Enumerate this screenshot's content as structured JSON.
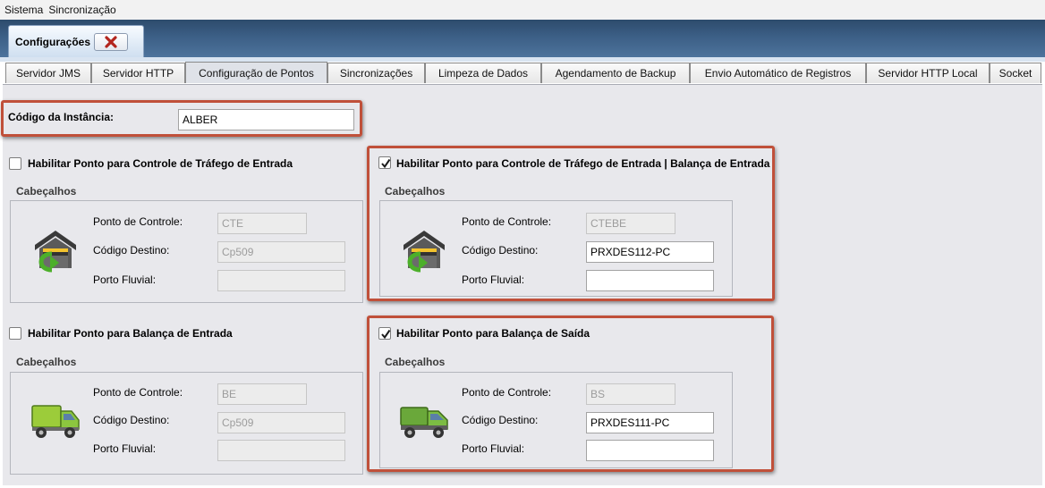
{
  "menu": {
    "items": [
      "Sistema",
      "Sincronização"
    ]
  },
  "app_tab": {
    "label": "Configurações"
  },
  "tabs": [
    "Servidor JMS",
    "Servidor HTTP",
    "Configuração de Pontos",
    "Sincronizações",
    "Limpeza de Dados",
    "Agendamento de Backup",
    "Envio Automático de Registros",
    "Servidor HTTP Local",
    "Socket"
  ],
  "active_tab": "Configuração de Pontos",
  "instance": {
    "label": "Código da Instância:",
    "value": "ALBER"
  },
  "field_labels": {
    "ponto": "Ponto de Controle:",
    "destino": "Código Destino:",
    "fluvial": "Porto Fluvial:"
  },
  "sections": {
    "trafego_entrada": {
      "checkbox_label": "Habilitar Ponto para Controle de Tráfego de Entrada",
      "checked": false,
      "header": "Cabeçalhos",
      "ponto": "CTE",
      "destino": "Cp509",
      "fluvial": "",
      "icon": "garage-arrow-icon"
    },
    "trafego_balanca_entrada": {
      "checkbox_label": "Habilitar Ponto para Controle de Tráfego de Entrada | Balança de Entrada",
      "checked": true,
      "header": "Cabeçalhos",
      "ponto": "CTEBE",
      "destino": "PRXDES112-PC",
      "fluvial": "",
      "icon": "garage-arrow-icon"
    },
    "balanca_entrada": {
      "checkbox_label": "Habilitar Ponto para Balança de Entrada",
      "checked": false,
      "header": "Cabeçalhos",
      "ponto": "BE",
      "destino": "Cp509",
      "fluvial": "",
      "icon": "truck-icon"
    },
    "balanca_saida": {
      "checkbox_label": "Habilitar Ponto para Balança de Saída",
      "checked": true,
      "header": "Cabeçalhos",
      "ponto": "BS",
      "destino": "PRXDES111-PC",
      "fluvial": "",
      "icon": "truck-icon"
    }
  },
  "colors": {
    "highlight": "#c0503a",
    "title_bar": "#3c5f86",
    "active_tab": "#dfe2e8"
  }
}
